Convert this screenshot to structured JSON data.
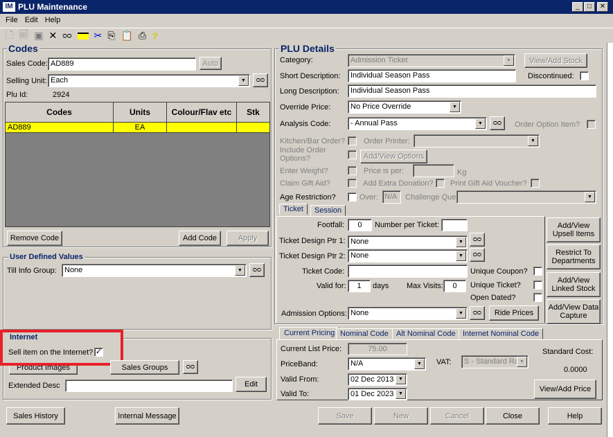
{
  "window": {
    "title": "PLU Maintenance",
    "logo": "IM",
    "min": "_",
    "max": "□",
    "close": "✕"
  },
  "menu": [
    "File",
    "Edit",
    "Help"
  ],
  "toolbar": [
    "new",
    "copy",
    "save",
    "delete",
    "find",
    "card",
    "cut",
    "copy-clip",
    "paste",
    "print",
    "help"
  ],
  "codes": {
    "title": "Codes",
    "sales_code_label": "Sales Code:",
    "sales_code": "AD889",
    "auto": "Auto",
    "selling_unit_label": "Selling Unit:",
    "selling_unit": "Each",
    "plu_id_label": "Plu Id:",
    "plu_id": "2924",
    "columns": [
      "Codes",
      "Units",
      "Colour/Flav etc",
      "Stk"
    ],
    "rows": [
      [
        "AD889",
        "EA",
        "",
        ""
      ]
    ],
    "remove": "Remove Code",
    "add": "Add Code",
    "apply": "Apply"
  },
  "udv": {
    "title": "User Defined Values",
    "till_label": "Till Info Group:",
    "till": "None"
  },
  "internet": {
    "title": "Internet",
    "sell_label": "Sell item on the Internet?",
    "sell": true,
    "product_images": "Product Images",
    "sales_groups": "Sales Groups",
    "ext_label": "Extended Desc",
    "ext": "",
    "edit": "Edit"
  },
  "plu": {
    "title": "PLU Details",
    "category_label": "Category:",
    "category": "Admission Ticket",
    "view_stock": "View/Add Stock",
    "short_label": "Short Description:",
    "short": "Individual Season Pass",
    "discontinued_label": "Discontinued:",
    "long_label": "Long Description:",
    "long": "Individual Season Pass",
    "override_label": "Override Price:",
    "override": "No Price Override",
    "analysis_label": "Analysis Code:",
    "analysis": "- Annual Pass",
    "order_option_label": "Order Option Item?",
    "kitchen_label": "Kitchen/Bar Order?",
    "printer_label": "Order Printer:",
    "include_label": "Include Order Options?",
    "options_btn": "Add/View Options",
    "weight_label": "Enter Weight?",
    "price_per_label": "Price is per:",
    "kg": "Kg",
    "gift_label": "Claim Gift Aid?",
    "donation_label": "Add Extra Donation?",
    "voucher_label": "Print Gift Aid Voucher?",
    "age_label": "Age Restriction?",
    "over_label": "Over:",
    "over": "N/A",
    "challenge_label": "Challenge Question:"
  },
  "ticket": {
    "tabs": [
      "Ticket",
      "Session"
    ],
    "footfall_label": "Footfall:",
    "footfall": "0",
    "per_ticket_label": "Number per Ticket:",
    "per_ticket": "",
    "ptr1_label": "Ticket Design Ptr 1:",
    "ptr1": "None",
    "ptr2_label": "Ticket Design Ptr 2:",
    "ptr2": "None",
    "code_label": "Ticket Code:",
    "code": "",
    "coupon_label": "Unique Coupon?",
    "valid_label": "Valid for:",
    "valid": "1",
    "days": "days",
    "visits_label": "Max Visits:",
    "visits": "0",
    "unique_ticket_label": "Unique Ticket?",
    "open_label": "Open Dated?",
    "adm_label": "Admission Options:",
    "adm": "None",
    "ride": "Ride Prices",
    "side": [
      "Add/View Upsell Items",
      "Restrict To Departments",
      "Add/View Linked Stock",
      "Add/View Data Capture"
    ]
  },
  "pricing": {
    "tabs": [
      "Current Pricing",
      "Nominal Code",
      "Alt Nominal Code",
      "Internet Nominal Code"
    ],
    "list_label": "Current List Price:",
    "list": "75.00",
    "band_label": "PriceBand:",
    "band": "N/A",
    "vat_label": "VAT:",
    "vat": "S - Standard Ra",
    "std_label": "Standard Cost:",
    "std": "0.0000",
    "from_label": "Valid From:",
    "from": "02 Dec 2013",
    "to_label": "Valid To:",
    "to": "01 Dec 2023",
    "view_price": "View/Add Price"
  },
  "footer": {
    "history": "Sales History",
    "message": "Internal Message",
    "save": "Save",
    "new": "New",
    "cancel": "Cancel",
    "close": "Close",
    "help": "Help"
  }
}
